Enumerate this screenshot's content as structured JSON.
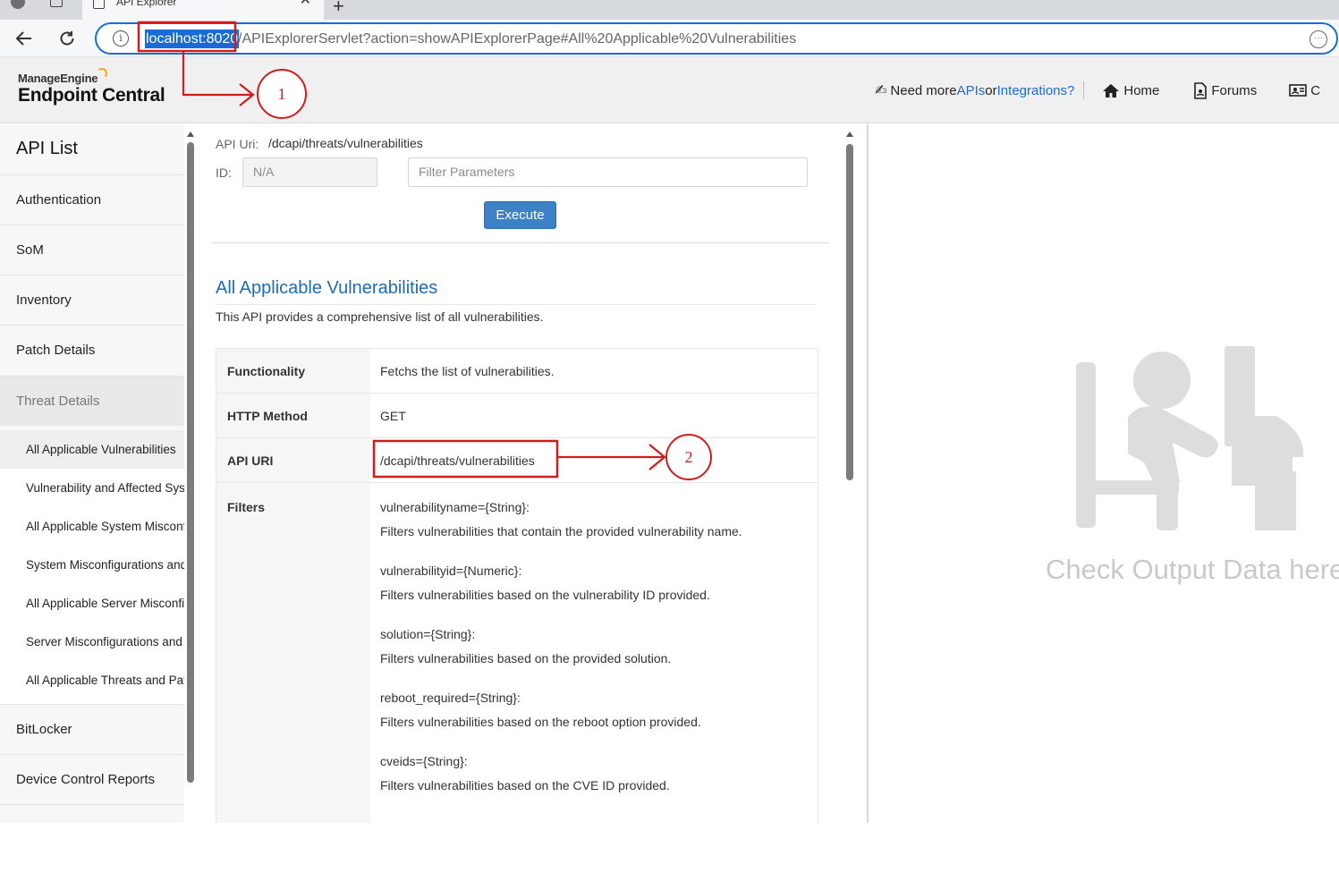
{
  "browser": {
    "tab_title": "API Explorer",
    "address_host": "localhost:8020",
    "address_path": "/APIExplorerServlet?action=showAPIExplorerPage#All%20Applicable%20Vulnerabilities"
  },
  "header": {
    "brand_top": "ManageEngine",
    "brand_main": "Endpoint Central",
    "need_more_prefix": "Need more ",
    "need_more_apis": "APIs",
    "need_more_mid": " or ",
    "need_more_integrations": "Integrations",
    "need_more_suffix": " ?",
    "home": "Home",
    "forums": "Forums",
    "contact_partial": "C"
  },
  "sidebar": {
    "title": "API List",
    "items": [
      {
        "label": "Authentication"
      },
      {
        "label": "SoM"
      },
      {
        "label": "Inventory"
      },
      {
        "label": "Patch Details"
      },
      {
        "label": "Threat Details"
      },
      {
        "label": "BitLocker"
      },
      {
        "label": "Device Control Reports"
      }
    ],
    "threat_sub_items": [
      {
        "label": "All Applicable Vulnerabilities"
      },
      {
        "label": "Vulnerability and Affected Systems"
      },
      {
        "label": "All Applicable System Misconfigurations"
      },
      {
        "label": "System Misconfigurations and Affected Systems"
      },
      {
        "label": "All Applicable Server Misconfigurations"
      },
      {
        "label": "Server Misconfigurations and Affected Systems"
      },
      {
        "label": "All Applicable Threats and Patches"
      }
    ]
  },
  "request": {
    "api_uri_label": "API Uri:",
    "api_uri_value": "/dcapi/threats/vulnerabilities",
    "id_label": "ID:",
    "id_value": "N/A",
    "filter_placeholder": "Filter Parameters",
    "execute_label": "Execute"
  },
  "api": {
    "title": "All Applicable Vulnerabilities",
    "description": "This API provides a comprehensive list of all vulnerabilities.",
    "rows": {
      "functionality_key": "Functionality",
      "functionality_val": "Fetchs the list of vulnerabilities.",
      "method_key": "HTTP Method",
      "method_val": "GET",
      "uri_key": "API URI",
      "uri_val": "/dcapi/threats/vulnerabilities",
      "filters_key": "Filters"
    },
    "filters": [
      {
        "param": "vulnerabilityname={String}:",
        "desc": "Filters vulnerabilities that contain the provided vulnerability name."
      },
      {
        "param": "vulnerabilityid={Numeric}:",
        "desc": "Filters vulnerabilities based on the vulnerability ID provided."
      },
      {
        "param": "solution={String}:",
        "desc": "Filters vulnerabilities based on the provided solution."
      },
      {
        "param": "reboot_required={String}:",
        "desc": "Filters vulnerabilities based on the reboot option provided."
      },
      {
        "param": "cveids={String}:",
        "desc": "Filters vulnerabilities based on the CVE ID provided."
      }
    ]
  },
  "output": {
    "placeholder": "Check Output Data here"
  },
  "annotations": {
    "callout_1": "1",
    "callout_2": "2",
    "color": "#d01c1c"
  },
  "colors": {
    "accent_blue": "#1e6bb8",
    "execute_button": "#3d82c7",
    "address_selection": "#1a6bd6"
  }
}
